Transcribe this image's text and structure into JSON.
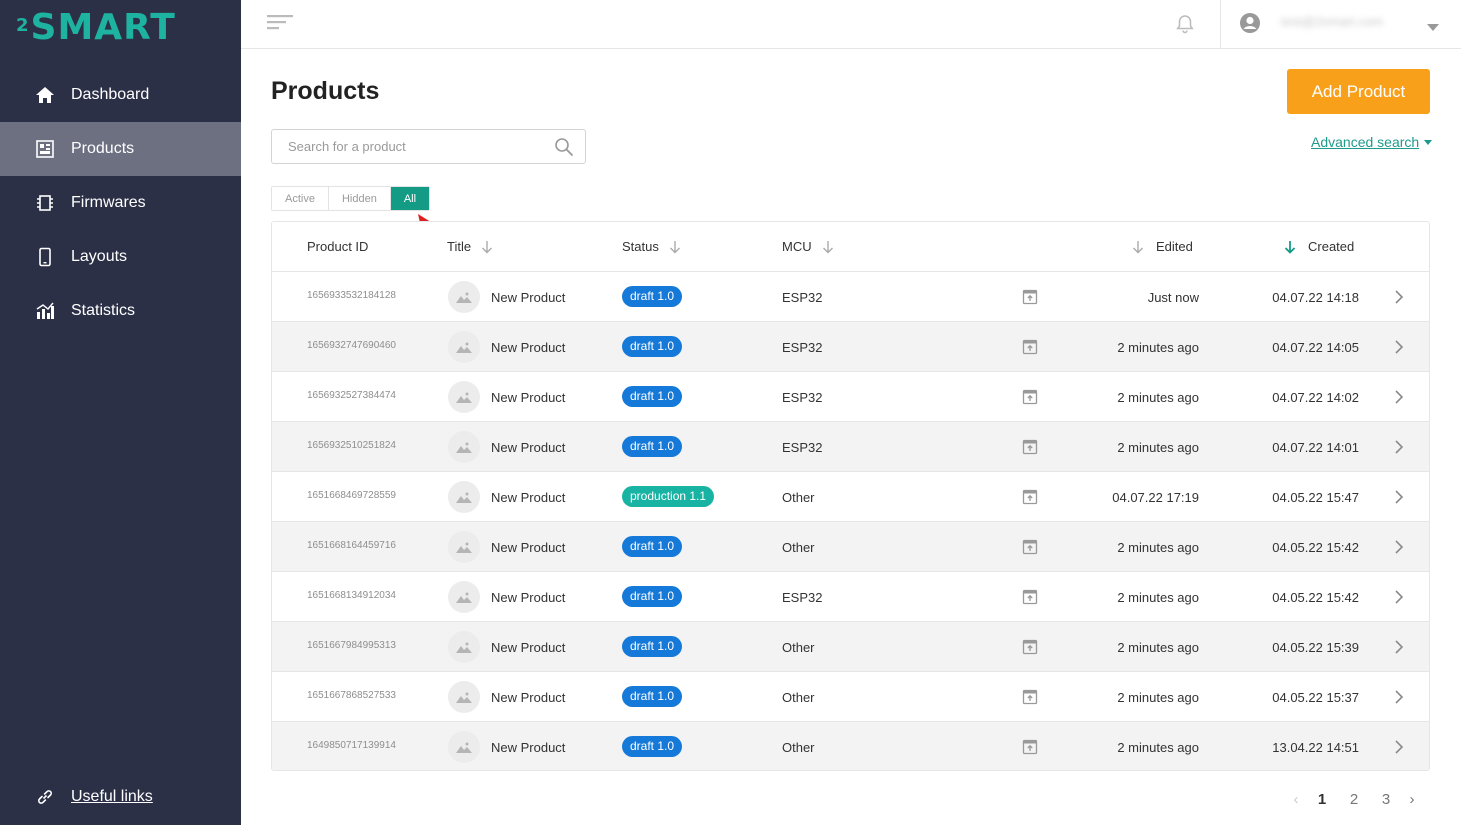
{
  "brand": {
    "logo_sup": "2",
    "logo_text": "SMART",
    "color": "#1db3a0"
  },
  "sidebar": {
    "items": [
      {
        "label": "Dashboard",
        "icon": "home-icon",
        "active": false
      },
      {
        "label": "Products",
        "icon": "products-icon",
        "active": true
      },
      {
        "label": "Firmwares",
        "icon": "chip-icon",
        "active": false
      },
      {
        "label": "Layouts",
        "icon": "phone-icon",
        "active": false
      },
      {
        "label": "Statistics",
        "icon": "stats-icon",
        "active": false
      }
    ],
    "footer_link": {
      "label": "Useful links",
      "icon": "link-icon"
    }
  },
  "topbar": {
    "menu_icon": "menu-icon",
    "bell_icon": "bell-icon",
    "user_email": "test@2smart.com"
  },
  "page": {
    "title": "Products",
    "add_button": "Add Product",
    "search_placeholder": "Search for a product",
    "advanced_search": "Advanced search",
    "tabs": [
      {
        "label": "Active",
        "active": false
      },
      {
        "label": "Hidden",
        "active": false
      },
      {
        "label": "All",
        "active": true
      }
    ]
  },
  "table": {
    "headers": {
      "id": "Product ID",
      "title": "Title",
      "status": "Status",
      "mcu": "MCU",
      "edited": "Edited",
      "created": "Created"
    },
    "rows": [
      {
        "id": "1656933532184128",
        "title": "New Product",
        "status": "draft 1.0",
        "status_type": "draft",
        "mcu": "ESP32",
        "edited": "Just now",
        "created": "04.07.22 14:18"
      },
      {
        "id": "1656932747690460",
        "title": "New Product",
        "status": "draft 1.0",
        "status_type": "draft",
        "mcu": "ESP32",
        "edited": "2 minutes ago",
        "created": "04.07.22 14:05"
      },
      {
        "id": "1656932527384474",
        "title": "New Product",
        "status": "draft 1.0",
        "status_type": "draft",
        "mcu": "ESP32",
        "edited": "2 minutes ago",
        "created": "04.07.22 14:02"
      },
      {
        "id": "1656932510251824",
        "title": "New Product",
        "status": "draft 1.0",
        "status_type": "draft",
        "mcu": "ESP32",
        "edited": "2 minutes ago",
        "created": "04.07.22 14:01"
      },
      {
        "id": "1651668469728559",
        "title": "New Product",
        "status": "production 1.1",
        "status_type": "production",
        "mcu": "Other",
        "edited": "04.07.22 17:19",
        "created": "04.05.22 15:47"
      },
      {
        "id": "1651668164459716",
        "title": "New Product",
        "status": "draft 1.0",
        "status_type": "draft",
        "mcu": "Other",
        "edited": "2 minutes ago",
        "created": "04.05.22 15:42"
      },
      {
        "id": "1651668134912034",
        "title": "New Product",
        "status": "draft 1.0",
        "status_type": "draft",
        "mcu": "ESP32",
        "edited": "2 minutes ago",
        "created": "04.05.22 15:42"
      },
      {
        "id": "1651667984995313",
        "title": "New Product",
        "status": "draft 1.0",
        "status_type": "draft",
        "mcu": "Other",
        "edited": "2 minutes ago",
        "created": "04.05.22 15:39"
      },
      {
        "id": "1651667868527533",
        "title": "New Product",
        "status": "draft 1.0",
        "status_type": "draft",
        "mcu": "Other",
        "edited": "2 minutes ago",
        "created": "04.05.22 15:37"
      },
      {
        "id": "1649850717139914",
        "title": "New Product",
        "status": "draft 1.0",
        "status_type": "draft",
        "mcu": "Other",
        "edited": "2 minutes ago",
        "created": "13.04.22 14:51"
      }
    ]
  },
  "pagination": {
    "pages": [
      "1",
      "2",
      "3"
    ],
    "current": "1",
    "prev": "‹",
    "next": "›"
  },
  "colors": {
    "sidebar_bg": "#2b3047",
    "sidebar_active": "#6c7081",
    "accent_orange": "#f9a01b",
    "accent_teal": "#149b86",
    "draft_badge": "#1479d8",
    "production_badge": "#19b3a4",
    "annotation_arrow": "#e02020"
  }
}
